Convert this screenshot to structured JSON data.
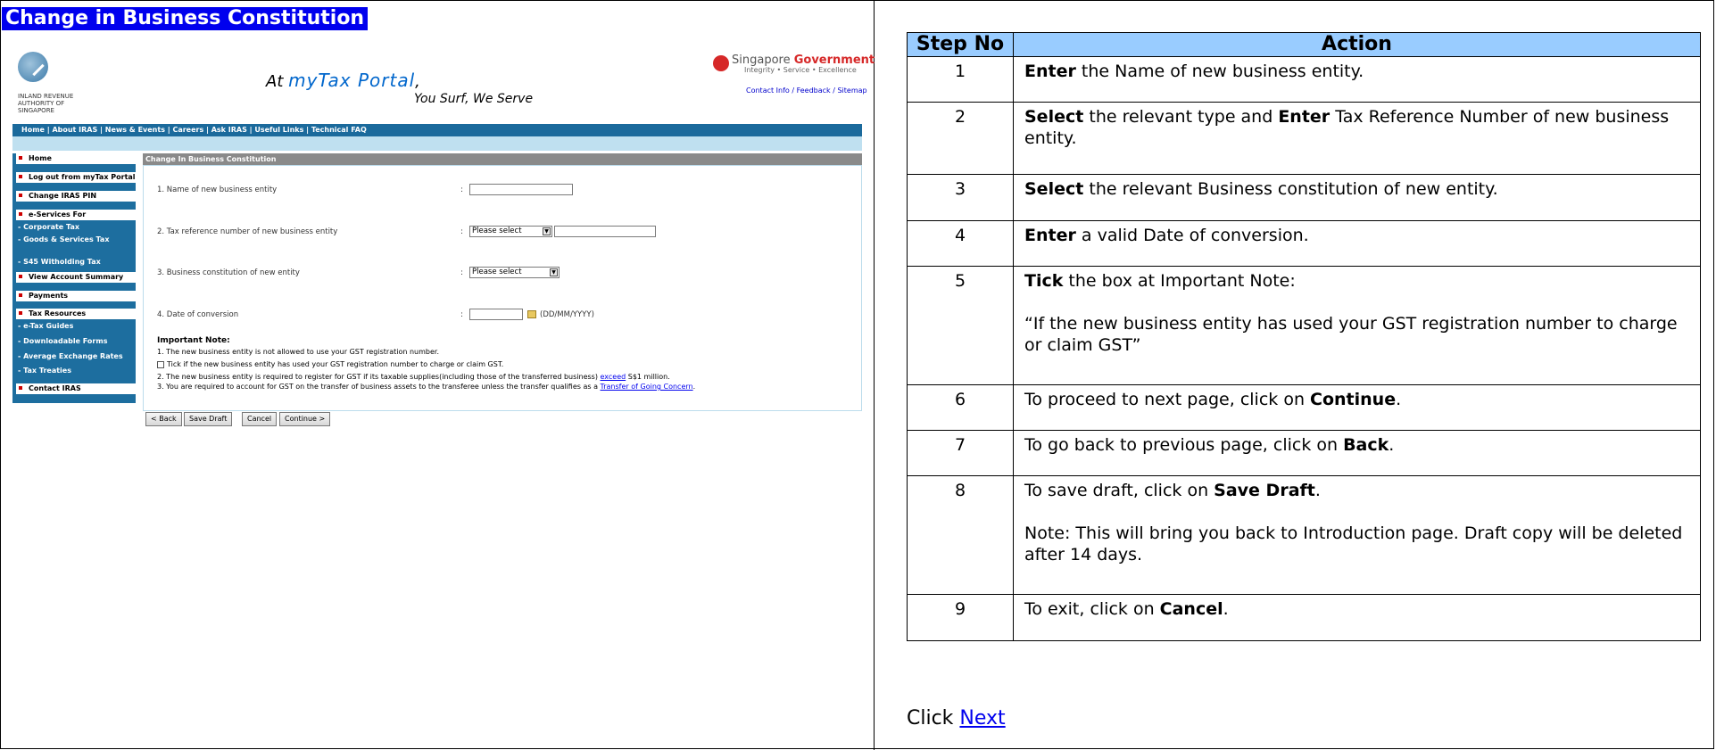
{
  "heading": "Change in Business Constitution",
  "screenshot": {
    "iras_name": "INLAND REVENUE AUTHORITY OF SINGAPORE",
    "tagline_at": "At",
    "tagline_brand": "myTax Portal",
    "tagline_comma": ",",
    "tagline_2": "You Surf, We Serve",
    "sg_gov_1": "Singapore",
    "sg_gov_2": "Government",
    "sg_gov_sub": "Integrity • Service • Excellence",
    "top_links": "Contact Info / Feedback / Sitemap",
    "nav": "Home  |  About IRAS  |  News & Events  |  Careers  |  Ask IRAS  |  Useful Links  |  Technical FAQ",
    "sidebar": {
      "home": "Home",
      "logout": "Log out from myTax Portal",
      "change_pin": "Change IRAS PIN",
      "eservices": "e-Services For",
      "corporate_tax": "- Corporate Tax",
      "gst": "- Goods & Services Tax",
      "s45": "- S45 Witholding Tax",
      "view_account": "View Account Summary",
      "payments": "Payments",
      "tax_resources": "Tax Resources",
      "etax_guides": "- e-Tax Guides",
      "forms": "- Downloadable Forms",
      "rates": "- Average Exchange Rates",
      "treaties": "- Tax Treaties",
      "contact": "Contact IRAS"
    },
    "content_title": "Change In Business Constitution",
    "fields": {
      "f1": "1.   Name of new business entity",
      "f2": "2.   Tax reference number of new business entity",
      "f3": "3.   Business constitution of new entity",
      "f4": "4.   Date of conversion",
      "colon": ":",
      "select_placeholder": "Please select",
      "date_format": "(DD/MM/YYYY)"
    },
    "note": {
      "title": "Important Note:",
      "line1": "1. The new business entity is not allowed to use your GST registration number.",
      "tick": "Tick if the new business entity has used your GST registration number to charge or claim GST.",
      "line2a": "2. The new business entity is required to register for GST if its taxable supplies(including those of the transferred business)",
      "line2_link": "exceed",
      "line2b": "S$1 million.",
      "line3a": "3. You are required to account for GST on the transfer of business assets to the transferee unless the transfer qualifies as a",
      "line3_link": "Transfer of Going Concern",
      "line3b": "."
    },
    "buttons": {
      "back": "< Back",
      "save_draft": "Save Draft",
      "cancel": "Cancel",
      "continue": "Continue >"
    }
  },
  "table": {
    "col_step": "Step No",
    "col_action": "Action",
    "rows": [
      {
        "no": "1",
        "b1": "Enter",
        "t1": " the Name of new business entity."
      },
      {
        "no": "2",
        "b1": "Select",
        "t1": " the relevant type and ",
        "b2": "Enter",
        "t2": " Tax Reference Number of new business entity."
      },
      {
        "no": "3",
        "b1": "Select",
        "t1": " the relevant Business constitution of new entity."
      },
      {
        "no": "4",
        "b1": "Enter",
        "t1": " a valid Date of conversion."
      },
      {
        "no": "5",
        "b1": "Tick",
        "t1": " the box at Important Note:",
        "quote": "“If the new business entity has used your GST registration number to charge or claim GST”"
      },
      {
        "no": "6",
        "t0": "To proceed to next page, click on ",
        "b1": "Continue",
        "t1": "."
      },
      {
        "no": "7",
        "t0": "To go back to previous page, click on ",
        "b1": "Back",
        "t1": "."
      },
      {
        "no": "8",
        "t0": "To save draft, click on ",
        "b1": "Save Draft",
        "t1": ".",
        "note": "Note: This will bring you back to Introduction page. Draft copy will be deleted after 14 days."
      },
      {
        "no": "9",
        "t0": "To exit, click on ",
        "b1": "Cancel",
        "t1": "."
      }
    ]
  },
  "footer": {
    "click": "Click ",
    "next": "Next"
  }
}
